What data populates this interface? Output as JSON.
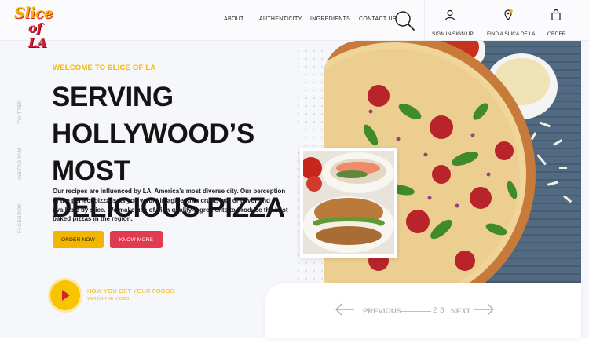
{
  "brand": {
    "logo_line1": "Slice",
    "logo_line2": "of LA"
  },
  "nav": {
    "links": [
      "ABOUT",
      "AUTHENTICITY",
      "INGREDIENTS",
      "CONTACT US"
    ],
    "account_label": "SIGN IN/SIGN UP",
    "find_label": "FIND A SLICA OF LA",
    "order_label": "ORDER"
  },
  "social": [
    "TWITTER",
    "INSTAGRAM",
    "FACEBOOK"
  ],
  "hero": {
    "eyebrow": "WELCOME TO SLICE OF LA",
    "headline_line1": "SERVING",
    "headline_line2": "HOLLYWOOD’S MOST",
    "headline_line3": "DELICIOUS PIZZA",
    "description": "Our recipes are influenced by LA, America’s most diverse city. Our perception of the perfect pizza is as you would imagine: thin crust, lots of flavor and available by slice. We make use of high quality-ingredients to produce the best baked pizzas in the region.",
    "order_button": "ORDER NOW",
    "more_button": "KNOW MORE"
  },
  "video": {
    "title": "HOW YOU GET YOUR FOODS",
    "subtitle": "WATCH THE VIDEO"
  },
  "pager": {
    "prev_label": "PREVIOUS",
    "next_label": "NEXT",
    "pages": [
      "2",
      "3"
    ]
  },
  "colors": {
    "accent_yellow": "#f2b600",
    "accent_red": "#e23a4e",
    "background": "#f6f7fb"
  }
}
